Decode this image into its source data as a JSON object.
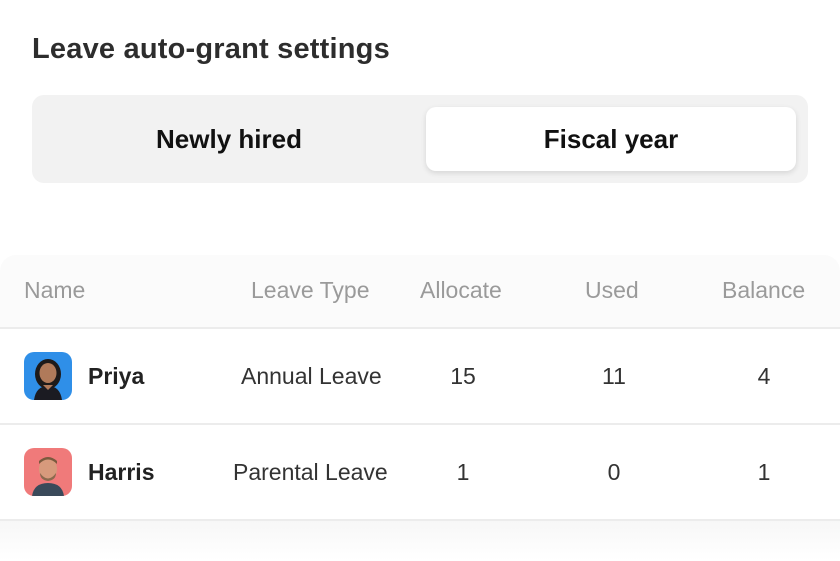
{
  "title": "Leave auto-grant settings",
  "tabs": {
    "newly_hired": "Newly hired",
    "fiscal_year": "Fiscal year",
    "selected": "Fiscal year"
  },
  "table": {
    "headers": {
      "name": "Name",
      "leave_type": "Leave Type",
      "allocate": "Allocate",
      "used": "Used",
      "balance": "Balance"
    },
    "rows": [
      {
        "name": "Priya",
        "leave_type": "Annual Leave",
        "allocate": "15",
        "used": "11",
        "balance": "4",
        "avatar_bg": "#2f8fe8"
      },
      {
        "name": "Harris",
        "leave_type": "Parental Leave",
        "allocate": "1",
        "used": "0",
        "balance": "1",
        "avatar_bg": "#f07a7a"
      }
    ]
  }
}
